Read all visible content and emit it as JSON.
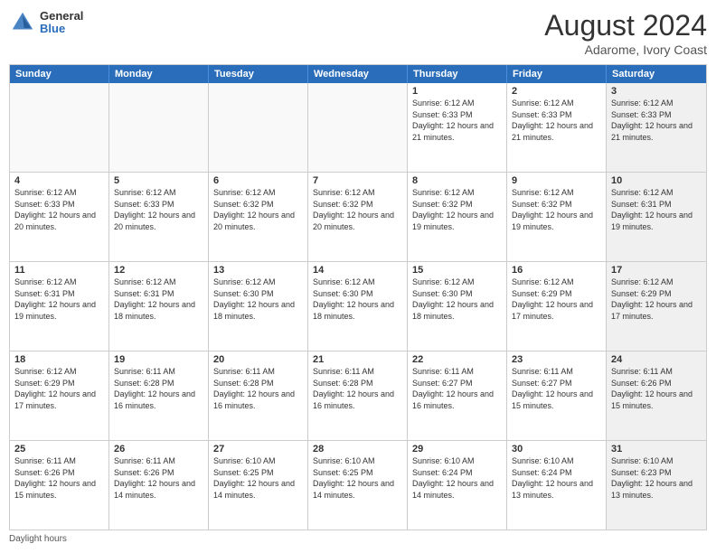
{
  "header": {
    "logo_general": "General",
    "logo_blue": "Blue",
    "month_title": "August 2024",
    "location": "Adarome, Ivory Coast"
  },
  "weekdays": [
    "Sunday",
    "Monday",
    "Tuesday",
    "Wednesday",
    "Thursday",
    "Friday",
    "Saturday"
  ],
  "footer_text": "Daylight hours",
  "weeks": [
    [
      {
        "day": "",
        "info": "",
        "empty": true
      },
      {
        "day": "",
        "info": "",
        "empty": true
      },
      {
        "day": "",
        "info": "",
        "empty": true
      },
      {
        "day": "",
        "info": "",
        "empty": true
      },
      {
        "day": "1",
        "info": "Sunrise: 6:12 AM\nSunset: 6:33 PM\nDaylight: 12 hours\nand 21 minutes.",
        "empty": false
      },
      {
        "day": "2",
        "info": "Sunrise: 6:12 AM\nSunset: 6:33 PM\nDaylight: 12 hours\nand 21 minutes.",
        "empty": false
      },
      {
        "day": "3",
        "info": "Sunrise: 6:12 AM\nSunset: 6:33 PM\nDaylight: 12 hours\nand 21 minutes.",
        "empty": false,
        "shaded": true
      }
    ],
    [
      {
        "day": "4",
        "info": "Sunrise: 6:12 AM\nSunset: 6:33 PM\nDaylight: 12 hours\nand 20 minutes.",
        "empty": false
      },
      {
        "day": "5",
        "info": "Sunrise: 6:12 AM\nSunset: 6:33 PM\nDaylight: 12 hours\nand 20 minutes.",
        "empty": false
      },
      {
        "day": "6",
        "info": "Sunrise: 6:12 AM\nSunset: 6:32 PM\nDaylight: 12 hours\nand 20 minutes.",
        "empty": false
      },
      {
        "day": "7",
        "info": "Sunrise: 6:12 AM\nSunset: 6:32 PM\nDaylight: 12 hours\nand 20 minutes.",
        "empty": false
      },
      {
        "day": "8",
        "info": "Sunrise: 6:12 AM\nSunset: 6:32 PM\nDaylight: 12 hours\nand 19 minutes.",
        "empty": false
      },
      {
        "day": "9",
        "info": "Sunrise: 6:12 AM\nSunset: 6:32 PM\nDaylight: 12 hours\nand 19 minutes.",
        "empty": false
      },
      {
        "day": "10",
        "info": "Sunrise: 6:12 AM\nSunset: 6:31 PM\nDaylight: 12 hours\nand 19 minutes.",
        "empty": false,
        "shaded": true
      }
    ],
    [
      {
        "day": "11",
        "info": "Sunrise: 6:12 AM\nSunset: 6:31 PM\nDaylight: 12 hours\nand 19 minutes.",
        "empty": false
      },
      {
        "day": "12",
        "info": "Sunrise: 6:12 AM\nSunset: 6:31 PM\nDaylight: 12 hours\nand 18 minutes.",
        "empty": false
      },
      {
        "day": "13",
        "info": "Sunrise: 6:12 AM\nSunset: 6:30 PM\nDaylight: 12 hours\nand 18 minutes.",
        "empty": false
      },
      {
        "day": "14",
        "info": "Sunrise: 6:12 AM\nSunset: 6:30 PM\nDaylight: 12 hours\nand 18 minutes.",
        "empty": false
      },
      {
        "day": "15",
        "info": "Sunrise: 6:12 AM\nSunset: 6:30 PM\nDaylight: 12 hours\nand 18 minutes.",
        "empty": false
      },
      {
        "day": "16",
        "info": "Sunrise: 6:12 AM\nSunset: 6:29 PM\nDaylight: 12 hours\nand 17 minutes.",
        "empty": false
      },
      {
        "day": "17",
        "info": "Sunrise: 6:12 AM\nSunset: 6:29 PM\nDaylight: 12 hours\nand 17 minutes.",
        "empty": false,
        "shaded": true
      }
    ],
    [
      {
        "day": "18",
        "info": "Sunrise: 6:12 AM\nSunset: 6:29 PM\nDaylight: 12 hours\nand 17 minutes.",
        "empty": false
      },
      {
        "day": "19",
        "info": "Sunrise: 6:11 AM\nSunset: 6:28 PM\nDaylight: 12 hours\nand 16 minutes.",
        "empty": false
      },
      {
        "day": "20",
        "info": "Sunrise: 6:11 AM\nSunset: 6:28 PM\nDaylight: 12 hours\nand 16 minutes.",
        "empty": false
      },
      {
        "day": "21",
        "info": "Sunrise: 6:11 AM\nSunset: 6:28 PM\nDaylight: 12 hours\nand 16 minutes.",
        "empty": false
      },
      {
        "day": "22",
        "info": "Sunrise: 6:11 AM\nSunset: 6:27 PM\nDaylight: 12 hours\nand 16 minutes.",
        "empty": false
      },
      {
        "day": "23",
        "info": "Sunrise: 6:11 AM\nSunset: 6:27 PM\nDaylight: 12 hours\nand 15 minutes.",
        "empty": false
      },
      {
        "day": "24",
        "info": "Sunrise: 6:11 AM\nSunset: 6:26 PM\nDaylight: 12 hours\nand 15 minutes.",
        "empty": false,
        "shaded": true
      }
    ],
    [
      {
        "day": "25",
        "info": "Sunrise: 6:11 AM\nSunset: 6:26 PM\nDaylight: 12 hours\nand 15 minutes.",
        "empty": false
      },
      {
        "day": "26",
        "info": "Sunrise: 6:11 AM\nSunset: 6:26 PM\nDaylight: 12 hours\nand 14 minutes.",
        "empty": false
      },
      {
        "day": "27",
        "info": "Sunrise: 6:10 AM\nSunset: 6:25 PM\nDaylight: 12 hours\nand 14 minutes.",
        "empty": false
      },
      {
        "day": "28",
        "info": "Sunrise: 6:10 AM\nSunset: 6:25 PM\nDaylight: 12 hours\nand 14 minutes.",
        "empty": false
      },
      {
        "day": "29",
        "info": "Sunrise: 6:10 AM\nSunset: 6:24 PM\nDaylight: 12 hours\nand 14 minutes.",
        "empty": false
      },
      {
        "day": "30",
        "info": "Sunrise: 6:10 AM\nSunset: 6:24 PM\nDaylight: 12 hours\nand 13 minutes.",
        "empty": false
      },
      {
        "day": "31",
        "info": "Sunrise: 6:10 AM\nSunset: 6:23 PM\nDaylight: 12 hours\nand 13 minutes.",
        "empty": false,
        "shaded": true
      }
    ]
  ]
}
